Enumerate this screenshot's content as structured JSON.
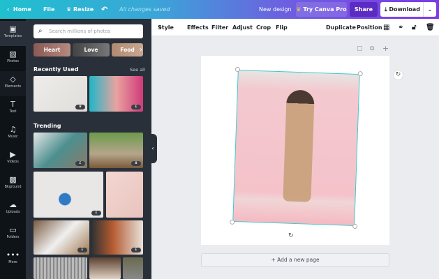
{
  "topbar": {
    "home": "Home",
    "file": "File",
    "resize": "Resize",
    "saved": "All changes saved",
    "new_design": "New design",
    "try_pro": "Try Canva Pro",
    "share": "Share",
    "download": "Download"
  },
  "rail": [
    {
      "label": "Templates",
      "icon": "templates-icon"
    },
    {
      "label": "Photos",
      "icon": "photos-icon"
    },
    {
      "label": "Elements",
      "icon": "elements-icon"
    },
    {
      "label": "Text",
      "icon": "text-icon"
    },
    {
      "label": "Music",
      "icon": "music-icon"
    },
    {
      "label": "Videos",
      "icon": "videos-icon"
    },
    {
      "label": "Bkground",
      "icon": "background-icon"
    },
    {
      "label": "Uploads",
      "icon": "uploads-icon"
    },
    {
      "label": "Folders",
      "icon": "folders-icon"
    },
    {
      "label": "More",
      "icon": "more-icon"
    }
  ],
  "panel": {
    "search_placeholder": "Search millions of photos",
    "chips": [
      "Heart",
      "Love",
      "Food"
    ],
    "recent": "Recently Used",
    "see_all": "See all",
    "trending": "Trending"
  },
  "toolbar": {
    "style": "Style",
    "effects": "Effects",
    "filter": "Filter",
    "adjust": "Adjust",
    "crop": "Crop",
    "flip": "Flip",
    "duplicate": "Duplicate",
    "position": "Position"
  },
  "canvas": {
    "add_page": "+ Add a new page"
  },
  "colors": {
    "accent": "#7d2ae8",
    "selection": "#3fc6cf"
  }
}
